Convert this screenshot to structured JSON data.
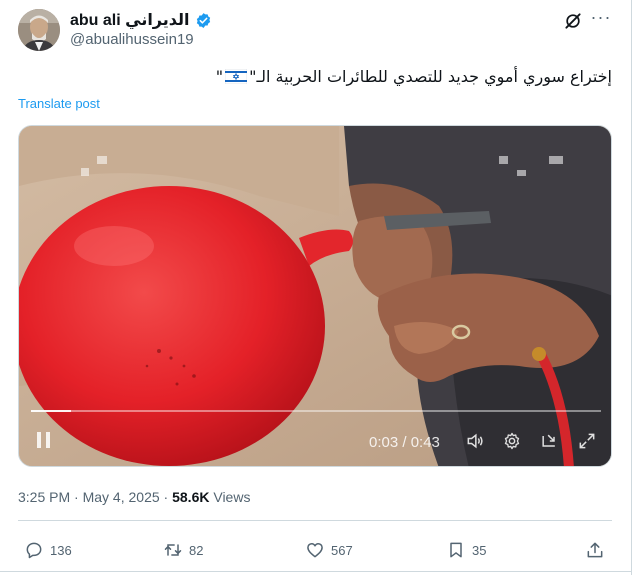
{
  "author": {
    "display_name": "abu ali الديراني",
    "handle": "@abualihussein19",
    "verified": true
  },
  "tweet": {
    "text_before_flag": "إختراع سوري أموي جديد للتصدي للطائرات الحربية الـ\"",
    "text_after_flag": "\"",
    "translate_label": "Translate post"
  },
  "video": {
    "time_display": "0:03 / 0:43",
    "progress": 0.07
  },
  "meta": {
    "time": "3:25 PM",
    "separator": "·",
    "date": "May 4, 2025",
    "views_count": "58.6K",
    "views_label": "Views"
  },
  "actions": {
    "replies": "136",
    "reposts": "82",
    "likes": "567",
    "bookmarks": "35"
  },
  "colors": {
    "accent": "#1d9bf0",
    "secondary_text": "#536471",
    "balloon": "#e8232b"
  }
}
